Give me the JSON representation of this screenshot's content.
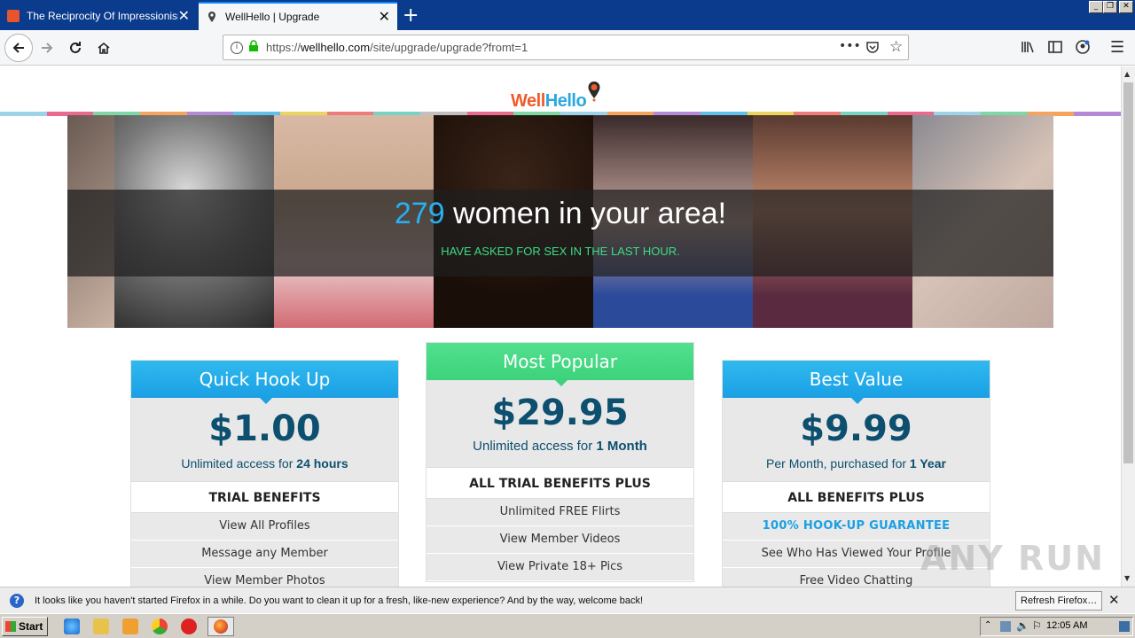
{
  "browser": {
    "tabs": [
      {
        "title": "The Reciprocity Of Impressionism |",
        "active": false
      },
      {
        "title": "WellHello | Upgrade",
        "active": true
      }
    ],
    "new_tab_label": "+",
    "url_prefix": "https://",
    "url_host": "wellhello.com",
    "url_path": "/site/upgrade/upgrade?fromt=1"
  },
  "site": {
    "logo_part1": "Well",
    "logo_part2": "Hello",
    "hero_number": "279",
    "hero_headline": " women in your area!",
    "hero_sub": "HAVE ASKED FOR SEX IN THE LAST HOUR."
  },
  "plans": [
    {
      "name": "Quick Hook Up",
      "price": "$1.00",
      "access_prefix": "Unlimited access for ",
      "access_bold": "24 hours",
      "benefits_title": "TRIAL BENEFITS",
      "features": [
        "View All Profiles",
        "Message any Member",
        "View Member Photos"
      ]
    },
    {
      "name": "Most Popular",
      "price": "$29.95",
      "access_prefix": "Unlimited access for ",
      "access_bold": "1 Month",
      "benefits_title": "ALL TRIAL BENEFITS PLUS",
      "features": [
        "Unlimited FREE Flirts",
        "View Member Videos",
        "View Private 18+ Pics"
      ]
    },
    {
      "name": "Best Value",
      "price": "$9.99",
      "access_prefix": "Per Month, purchased for ",
      "access_bold": "1 Year",
      "benefits_title": "ALL BENEFITS PLUS",
      "features": [
        "100% HOOK-UP GUARANTEE",
        "See Who Has Viewed Your Profile",
        "Free Video Chatting"
      ]
    }
  ],
  "notification": {
    "text": "It looks like you haven't started Firefox in a while. Do you want to clean it up for a fresh, like-new experience? And by the way, welcome back!",
    "button": "Refresh Firefox…"
  },
  "taskbar": {
    "start_label": "Start",
    "clock": "12:05 AM"
  },
  "watermark": "ANY RUN",
  "colors": {
    "accent_blue": "#1aa0e4",
    "accent_green": "#3dd27b",
    "price_text": "#0c4f6e",
    "logo_orange": "#ef5b2a"
  }
}
